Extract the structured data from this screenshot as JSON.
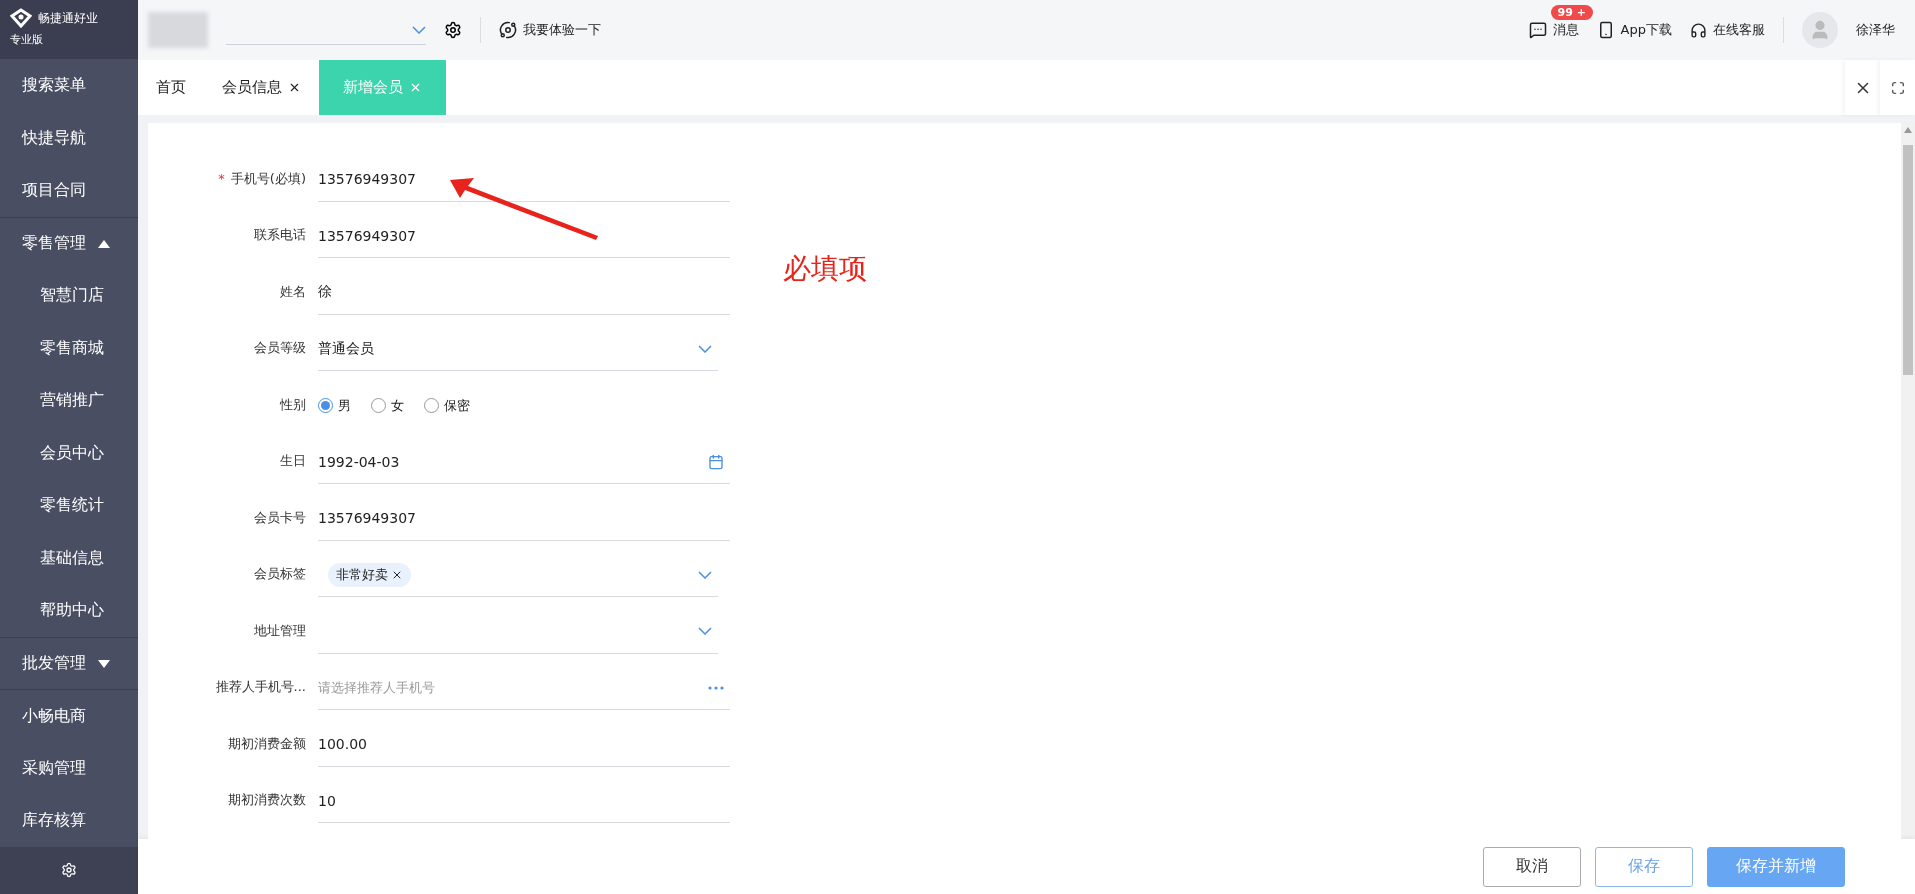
{
  "brand": {
    "name": "畅捷通好业",
    "edition": "专业版"
  },
  "topbar": {
    "try_link": "我要体验一下",
    "messages": {
      "label": "消息",
      "badge": "99 +"
    },
    "app_download": "App下载",
    "support": "在线客服",
    "user": "徐泽华"
  },
  "sidebar": {
    "items": [
      {
        "label": "搜索菜单"
      },
      {
        "label": "快捷导航"
      },
      {
        "label": "项目合同"
      },
      {
        "label": "零售管理",
        "expanded": true,
        "children": [
          {
            "label": "智慧门店"
          },
          {
            "label": "零售商城"
          },
          {
            "label": "营销推广"
          },
          {
            "label": "会员中心"
          },
          {
            "label": "零售统计"
          },
          {
            "label": "基础信息"
          },
          {
            "label": "帮助中心"
          }
        ]
      },
      {
        "label": "批发管理",
        "expanded": false
      },
      {
        "label": "小畅电商"
      },
      {
        "label": "采购管理"
      },
      {
        "label": "库存核算"
      }
    ]
  },
  "tabs": [
    {
      "label": "首页",
      "closable": false,
      "selected": false
    },
    {
      "label": "会员信息",
      "closable": true,
      "selected": false
    },
    {
      "label": "新增会员",
      "closable": true,
      "selected": true
    }
  ],
  "form": {
    "fields": [
      {
        "kind": "text",
        "label": "手机号(必填)",
        "required_mark": "*",
        "value": "13576949307"
      },
      {
        "kind": "text",
        "label": "联系电话",
        "value": "13576949307"
      },
      {
        "kind": "text",
        "label": "姓名",
        "value": "徐"
      },
      {
        "kind": "select",
        "label": "会员等级",
        "value": "普通会员"
      },
      {
        "kind": "radio",
        "label": "性别",
        "options": [
          {
            "label": "男",
            "selected": true
          },
          {
            "label": "女",
            "selected": false
          },
          {
            "label": "保密",
            "selected": false
          }
        ]
      },
      {
        "kind": "date",
        "label": "生日",
        "value": "1992-04-03"
      },
      {
        "kind": "text",
        "label": "会员卡号",
        "value": "13576949307"
      },
      {
        "kind": "tags",
        "label": "会员标签",
        "tags": [
          "非常好卖"
        ]
      },
      {
        "kind": "select",
        "label": "地址管理"
      },
      {
        "kind": "picker",
        "label": "推荐人手机号...",
        "placeholder": "请选择推荐人手机号"
      },
      {
        "kind": "text",
        "label": "期初消费金额",
        "value": "100.00"
      },
      {
        "kind": "text",
        "label": "期初消费次数",
        "value": "10"
      }
    ]
  },
  "annotation": {
    "text": "必填项"
  },
  "footer": {
    "buttons": [
      {
        "kind": "default",
        "label": "取消"
      },
      {
        "kind": "outline",
        "label": "保存"
      },
      {
        "kind": "primary",
        "label": "保存并新增"
      }
    ]
  }
}
